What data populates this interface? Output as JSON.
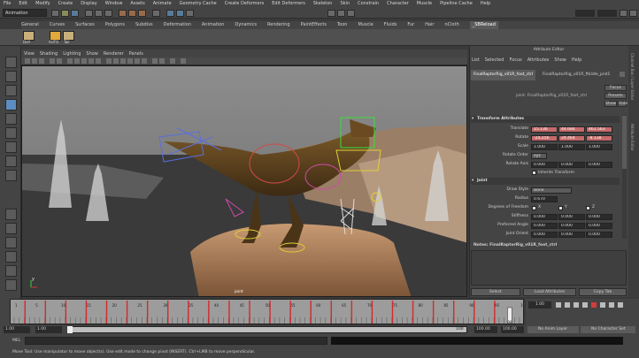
{
  "menubar": [
    "File",
    "Edit",
    "Modify",
    "Create",
    "Display",
    "Window",
    "Assets",
    "Animate",
    "Geometry Cache",
    "Create Deformers",
    "Edit Deformers",
    "Skeleton",
    "Skin",
    "Constrain",
    "Character",
    "Muscle",
    "Pipeline Cache",
    "Help"
  ],
  "status_line": {
    "mode": "Animation"
  },
  "shelf": {
    "tabs": [
      "General",
      "Curves",
      "Surfaces",
      "Polygons",
      "Subdivs",
      "Deformation",
      "Animation",
      "Dynamics",
      "Rendering",
      "PaintEffects",
      "Toon",
      "Muscle",
      "Fluids",
      "Fur",
      "Hair",
      "nCloth",
      "_SBReload"
    ],
    "active_tab": "_SBReload",
    "buttons": [
      "Doll",
      "AUTO",
      "Tail"
    ]
  },
  "viewport": {
    "menu": [
      "View",
      "Shading",
      "Lighting",
      "Show",
      "Renderer",
      "Panels"
    ],
    "axis_label": "y",
    "node_label": "joint"
  },
  "attribute_editor": {
    "title": "Attribute Editor",
    "menu": [
      "List",
      "Selected",
      "Focus",
      "Attributes",
      "Show",
      "Help"
    ],
    "tabs": [
      "FinalRaptorRig_v01R_foot_ctrl",
      "FinalRaptorRig_v01R_ftkIdle_pnd1"
    ],
    "node_label": "joint:",
    "node_name": "FinalRaptorRig_v01R_foot_ctrl",
    "side_buttons": [
      "Focus",
      "Presets",
      "Show",
      "Hide"
    ],
    "transform": {
      "header": "Transform Attributes",
      "translate_label": "Translate",
      "translate": [
        "15.136",
        "44.684",
        "461.563"
      ],
      "rotate_label": "Rotate",
      "rotate": [
        "-24.256",
        "24.464",
        "-8.138"
      ],
      "scale_label": "Scale",
      "scale": [
        "1.000",
        "1.000",
        "1.000"
      ],
      "rotate_order_label": "Rotate Order",
      "rotate_order": "xyz",
      "rotate_axis_label": "Rotate Axis",
      "rotate_axis": [
        "0.000",
        "0.000",
        "0.000"
      ],
      "inherits_label": "Inherits Transform"
    },
    "joint": {
      "header": "Joint",
      "draw_style_label": "Draw Style",
      "draw_style": "Bone",
      "radius_label": "Radius",
      "radius": "0.670",
      "dof_label": "Degrees of Freedom",
      "dof": [
        "X",
        "Y",
        "Z"
      ],
      "stiffness_label": "Stiffness",
      "stiffness": [
        "0.000",
        "0.000",
        "0.000"
      ],
      "preferred_label": "Preferred Angle",
      "preferred": [
        "0.000",
        "0.000",
        "0.000"
      ],
      "orient_label": "Joint Orient",
      "orient": [
        "0.000",
        "0.000",
        "0.000"
      ]
    },
    "notes_label": "Notes: FinalRaptorRig_v01R_foot_ctrl",
    "bottom_buttons": [
      "Select",
      "Load Attributes",
      "Copy Tab"
    ]
  },
  "right_strip": [
    "Channel Box / Layer Editor",
    "Attribute Editor"
  ],
  "timeline": {
    "ticks": [
      "1",
      "5",
      "10",
      "15",
      "20",
      "25",
      "30",
      "35",
      "40",
      "45",
      "50",
      "55",
      "60",
      "65",
      "70",
      "75",
      "80",
      "85",
      "90",
      "95",
      "100"
    ],
    "current_frame": "1.00",
    "playhead_label": "98"
  },
  "range": {
    "start": "1.00",
    "start_inner": "1.00",
    "end_inner": "100",
    "end": "100.00",
    "end_outer": "100.00",
    "anim_layer": "No Anim Layer",
    "character_set": "No Character Set"
  },
  "command_line": {
    "label": "MEL"
  },
  "help_line": "Move Tool: Use manipulator to move object(s). Use edit mode to change pivot (INSERT). Ctrl+LMB to move perpendicular."
}
